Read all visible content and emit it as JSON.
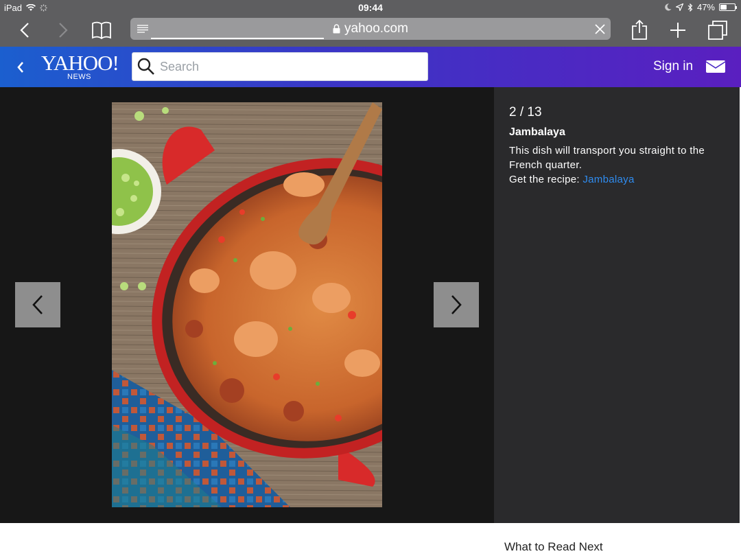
{
  "status_bar": {
    "device": "iPad",
    "time": "09:44",
    "battery": "47%",
    "battery_level": 0.47
  },
  "browser": {
    "url": "yahoo.com",
    "load_progress": 0.36
  },
  "yahoo": {
    "logo_text": "YAHOO!",
    "logo_sub": "NEWS",
    "search_placeholder": "Search",
    "sign_in": "Sign in"
  },
  "slideshow": {
    "counter": "2 / 13",
    "title": "Jambalaya",
    "description": "This dish will transport you straight to the French quarter.",
    "recipe_prefix": "Get the recipe:",
    "recipe_link": "Jambalaya"
  },
  "footer": {
    "read_next": "What to Read Next"
  },
  "colors": {
    "header_gradient_start": "#1b5fcf",
    "header_gradient_end": "#5a1fc0",
    "link": "#2f8cf0"
  }
}
